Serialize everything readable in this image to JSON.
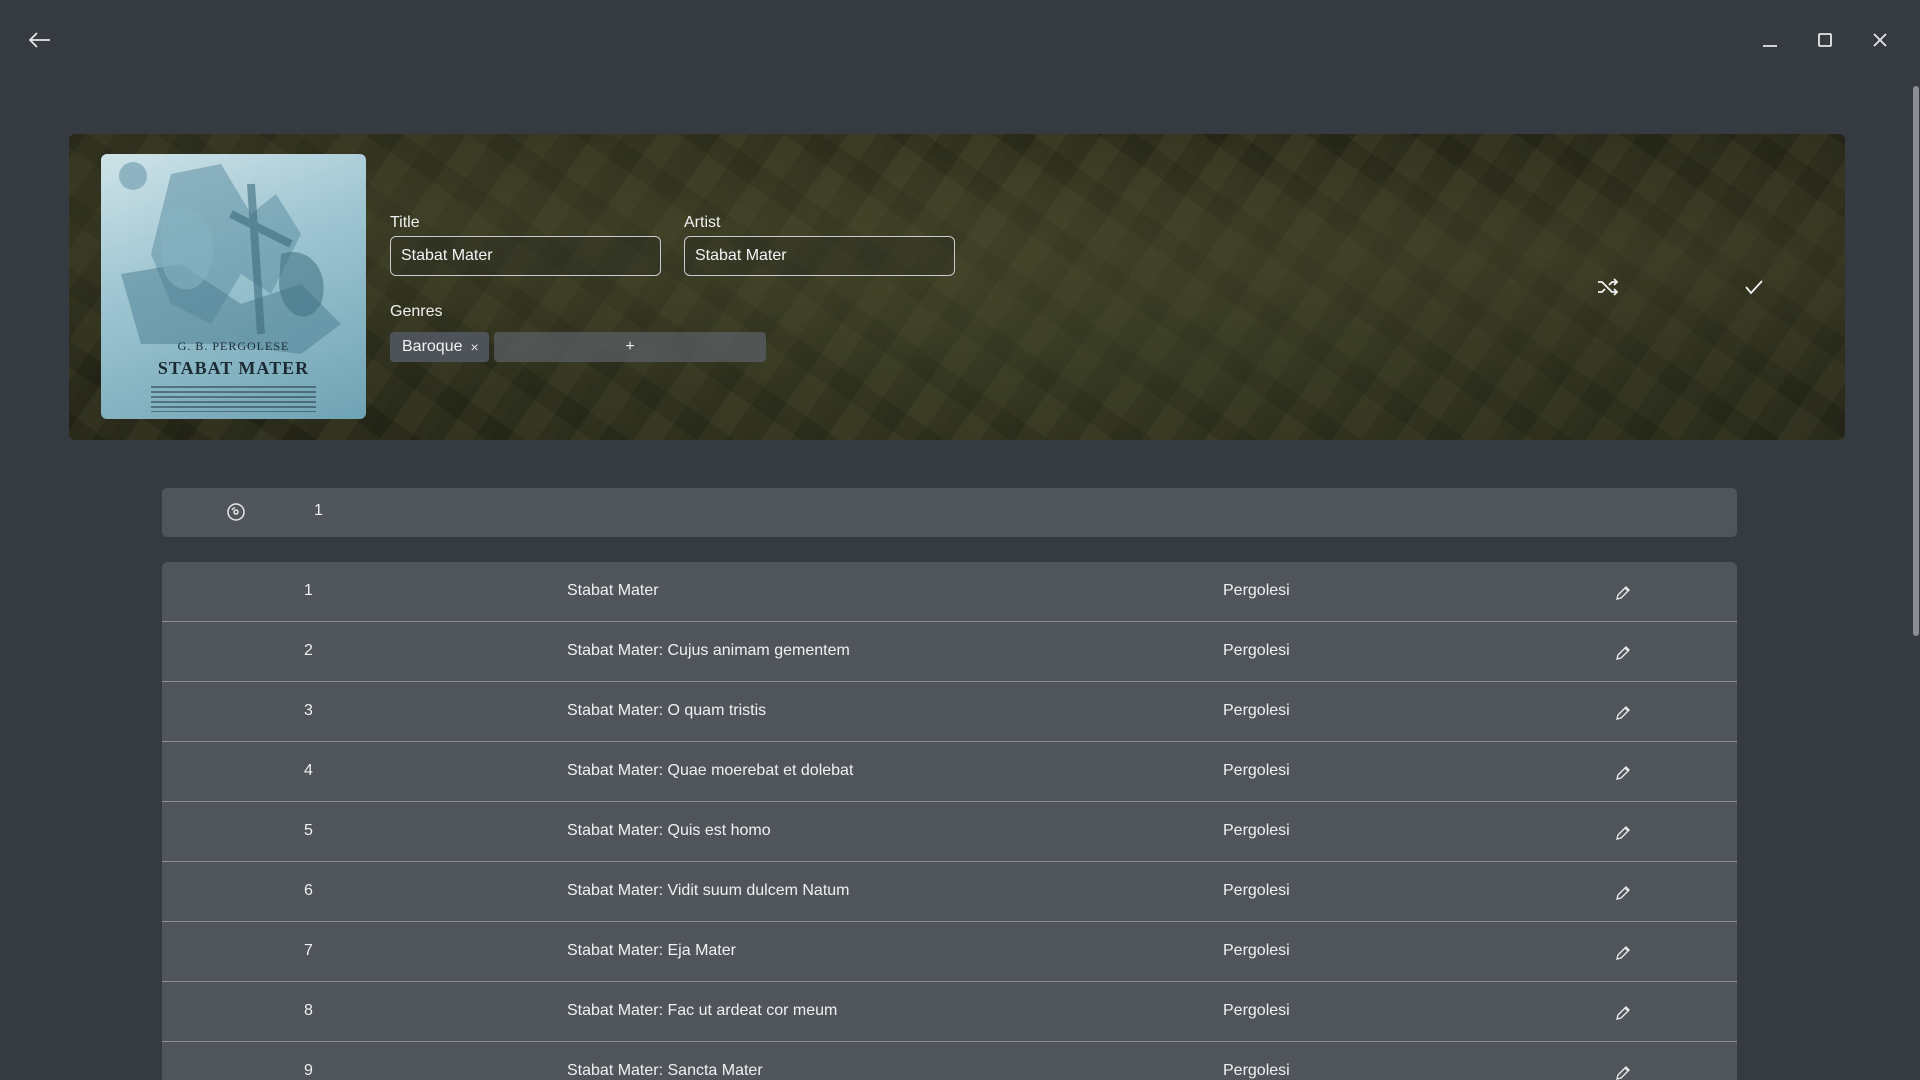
{
  "window": {
    "back_icon": "arrow-left-icon",
    "minimize_icon": "minimize-icon",
    "maximize_icon": "maximize-icon",
    "close_icon": "close-icon"
  },
  "album": {
    "cover": {
      "composer_text": "G. B. PERGOLESE",
      "work_text": "STABAT MATER"
    },
    "title_label": "Title",
    "title_value": "Stabat Mater",
    "artist_label": "Artist",
    "artist_value": "Stabat Mater",
    "genres_label": "Genres",
    "genres": [
      "Baroque"
    ],
    "genre_remove_glyph": "×",
    "genre_add_label": "+",
    "shuffle_icon": "shuffle-icon",
    "confirm_icon": "check-icon"
  },
  "disc": {
    "icon": "disc-icon",
    "number": "1"
  },
  "tracks": [
    {
      "num": "1",
      "title": "Stabat Mater",
      "artist": "Pergolesi"
    },
    {
      "num": "2",
      "title": "Stabat Mater: Cujus animam gementem",
      "artist": "Pergolesi"
    },
    {
      "num": "3",
      "title": "Stabat Mater: O quam tristis",
      "artist": "Pergolesi"
    },
    {
      "num": "4",
      "title": "Stabat Mater: Quae moerebat et dolebat",
      "artist": "Pergolesi"
    },
    {
      "num": "5",
      "title": "Stabat Mater: Quis est homo",
      "artist": "Pergolesi"
    },
    {
      "num": "6",
      "title": "Stabat Mater: Vidit suum dulcem Natum",
      "artist": "Pergolesi"
    },
    {
      "num": "7",
      "title": "Stabat Mater: Eja Mater",
      "artist": "Pergolesi"
    },
    {
      "num": "8",
      "title": "Stabat Mater: Fac ut ardeat cor meum",
      "artist": "Pergolesi"
    },
    {
      "num": "9",
      "title": "Stabat Mater: Sancta Mater",
      "artist": "Pergolesi"
    }
  ],
  "colors": {
    "background": "#353b41",
    "row_background": "#50555c",
    "row_divider": "#8a8e93",
    "text": "#f0f0f0"
  }
}
